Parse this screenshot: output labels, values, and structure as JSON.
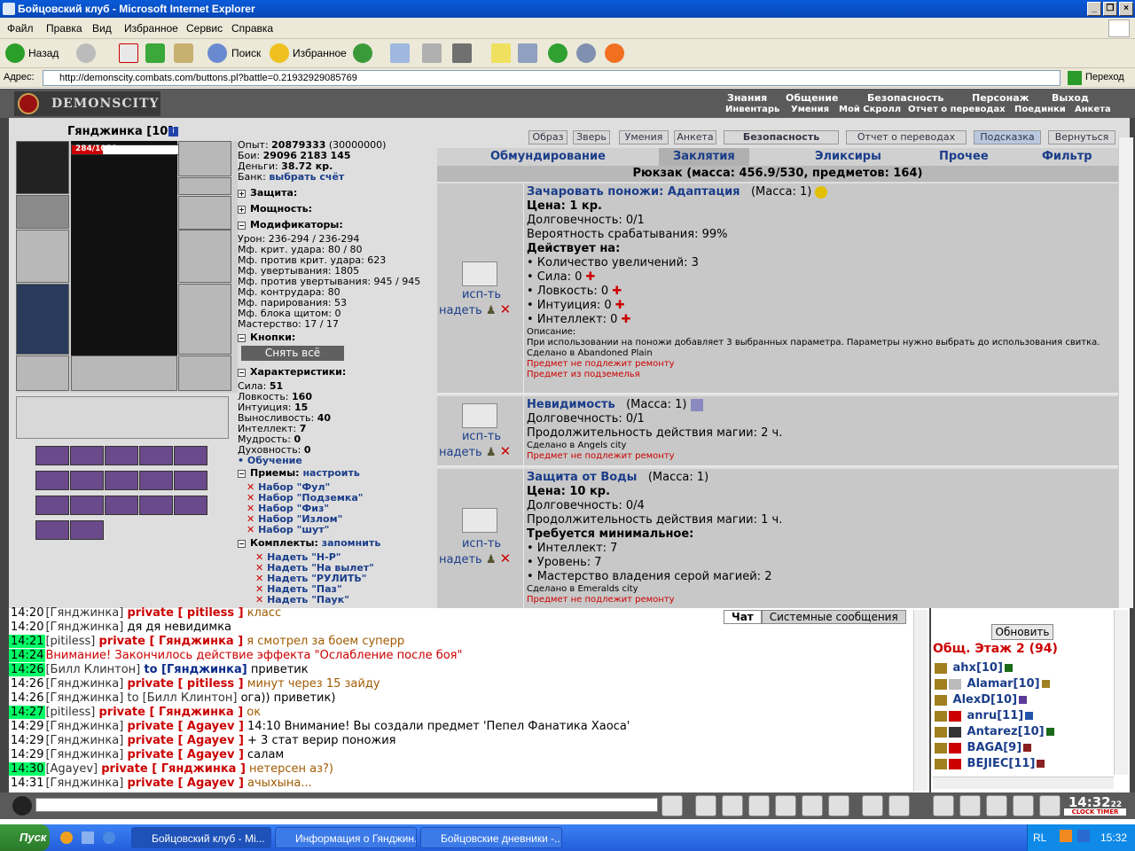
{
  "window": {
    "title": "Бойцовский клуб - Microsoft Internet Explorer"
  },
  "menu": [
    "Файл",
    "Правка",
    "Вид",
    "Избранное",
    "Сервис",
    "Справка"
  ],
  "toolbar": {
    "back": "Назад",
    "search": "Поиск",
    "favorites": "Избранное"
  },
  "address": {
    "label": "Адрес:",
    "url": "http://demonscity.combats.com/buttons.pl?battle=0.21932929085769",
    "go": "Переход"
  },
  "game_header": {
    "logo": "DEMONSCITY",
    "top_links": [
      "Знания",
      "Общение",
      "Безопасность",
      "Персонаж",
      "Выход"
    ],
    "sub_links": [
      "Инвентарь",
      "Умения",
      "Мой Скролл",
      "Отчет о переводах",
      "Поединки",
      "Анкета"
    ]
  },
  "character": {
    "name": "Гянджинка [10]",
    "hp": "284/1058",
    "hp_fraction": 0.27,
    "experience_label": "Опыт:",
    "experience": "20879333",
    "experience_next": "(30000000)",
    "fights_label": "Бои:",
    "wins": "29096",
    "losses": "2183",
    "draws": "145",
    "money_label": "Деньги:",
    "money": "38.72 кр.",
    "bank_label": "Банк:",
    "bank": "выбрать счёт"
  },
  "sections": {
    "protection": "Защита:",
    "power": "Мощность:",
    "modifiers": "Модификаторы:",
    "buttons": "Кнопки:",
    "stats": "Характеристики:",
    "tricks": "Приемы:",
    "tricks_setup": "настроить",
    "sets": "Комплекты:",
    "sets_save": "запомнить"
  },
  "modifiers": [
    "Урон: 236-294 / 236-294",
    "Мф. крит. удара: 80 / 80",
    "Мф. против крит. удара: 623",
    "Мф. увертывания: 1805",
    "Мф. против увертывания: 945 / 945",
    "Мф. контрудара: 80",
    "Мф. парирования: 53",
    "Мф. блока щитом: 0",
    "Мастерство: 17 / 17"
  ],
  "undress_button": "Снять всё",
  "stats": [
    {
      "label": "Сила:",
      "value": "51"
    },
    {
      "label": "Ловкость:",
      "value": "160"
    },
    {
      "label": "Интуиция:",
      "value": "15"
    },
    {
      "label": "Выносливость:",
      "value": "40"
    },
    {
      "label": "Интеллект:",
      "value": "7"
    },
    {
      "label": "Мудрость:",
      "value": "0"
    },
    {
      "label": "Духовность:",
      "value": "0"
    }
  ],
  "training": "• Обучение",
  "trick_sets": [
    "Набор \"Фул\"",
    "Набор \"Подземка\"",
    "Набор \"Физ\"",
    "Набор \"Излом\"",
    "Набор \"шут\""
  ],
  "kit_sets": [
    "Надеть \"Н-Р\"",
    "Надеть \"На вылет\"",
    "Надеть \"РУЛИТЬ\"",
    "Надеть \"Паз\"",
    "Надеть \"Паук\""
  ],
  "nav_buttons": [
    "Образ",
    "Зверь",
    "Умения",
    "Анкета",
    "Безопасность",
    "Отчет о переводах",
    "Подсказка",
    "Вернуться"
  ],
  "inv_tabs": [
    "Обмундирование",
    "Заклятия",
    "Эликсиры",
    "Прочее",
    "Фильтр"
  ],
  "rucksack": "Рюкзак (масса: 456.9/530, предметов: 164)",
  "item_actions": {
    "use": "исп-ть",
    "wear": "надеть"
  },
  "items": [
    {
      "name": "Зачаровать поножи: Адаптация",
      "mass": "(Масса: 1)",
      "lines": [
        "Цена: 1 кр.",
        "Долговечность: 0/1",
        "Вероятность срабатывания: 99%",
        "Действует на:"
      ],
      "bullets": [
        "• Количество увеличений: 3",
        "• Сила: 0",
        "• Ловкость: 0",
        "• Интуиция: 0",
        "• Интеллект: 0"
      ],
      "desc_label": "Описание:",
      "desc": "При использовании на поножи добавляет 3 выбранных параметра. Параметры нужно выбрать до использования свитка.",
      "made": "Сделано в Abandoned Plain",
      "red": [
        "Предмет не подлежит ремонту",
        "Предмет из подземелья"
      ]
    },
    {
      "name": "Невидимость",
      "mass": "(Масса: 1)",
      "lines": [
        "Долговечность: 0/1",
        "Продолжительность действия магии: 2 ч."
      ],
      "made": "Сделано в Angels city",
      "red": [
        "Предмет не подлежит ремонту"
      ]
    },
    {
      "name": "Защита от Воды",
      "mass": "(Масса: 1)",
      "lines": [
        "Цена: 10 кр.",
        "Долговечность: 0/4",
        "Продолжительность действия магии: 1 ч.",
        "Требуется минимальное:"
      ],
      "bullets": [
        "• Интеллект: 7",
        "• Уровень: 7",
        "• Мастерство владения серой магией: 2"
      ],
      "made": "Сделано в Emeralds city",
      "red": [
        "Предмет не подлежит ремонту"
      ]
    }
  ],
  "chat_tabs": [
    "Чат",
    "Системные сообщения"
  ],
  "chat": [
    {
      "t": "14:20",
      "hl": false,
      "nick": "[Гянджинка]",
      "kind": "priv",
      "to": "private [ pitiless ]",
      "msg": "класс",
      "mc": "txt"
    },
    {
      "t": "14:20",
      "hl": false,
      "nick": "[Гянджинка]",
      "kind": "",
      "to": "",
      "msg": "дя дя невидимка",
      "mc": "plain"
    },
    {
      "t": "14:21",
      "hl": true,
      "nick": "[pitiless]",
      "kind": "priv",
      "to": "private [ Гянджинка ]",
      "msg": "я смотрел за боем суперр",
      "mc": "txt"
    },
    {
      "t": "14:24",
      "hl": true,
      "nick": "",
      "kind": "warn",
      "to": "",
      "msg": "Внимание! Закончилось действие эффекта \"Ослабление после боя\"",
      "mc": "warn"
    },
    {
      "t": "14:26",
      "hl": true,
      "nick": "[Билл Клинтон]",
      "kind": "to",
      "to": "to [Гянджинка]",
      "msg": "приветик",
      "mc": "plain"
    },
    {
      "t": "14:26",
      "hl": false,
      "nick": "[Гянджинка]",
      "kind": "priv",
      "to": "private [ pitiless ]",
      "msg": "минут через 15 зайду",
      "mc": "txt"
    },
    {
      "t": "14:26",
      "hl": false,
      "nick": "[Гянджинка]",
      "kind": "plainto",
      "to": "to [Билл Клинтон]",
      "msg": "ога)) приветик)",
      "mc": "plain"
    },
    {
      "t": "14:27",
      "hl": true,
      "nick": "[pitiless]",
      "kind": "priv",
      "to": "private [ Гянджинка ]",
      "msg": "ок",
      "mc": "txt"
    },
    {
      "t": "14:29",
      "hl": false,
      "nick": "[Гянджинка]",
      "kind": "priv",
      "to": "private [ Agayev ]",
      "msg": "14:10 Внимание! Вы создали предмет 'Пепел Фанатика Хаоса'",
      "mc": "plain"
    },
    {
      "t": "14:29",
      "hl": false,
      "nick": "[Гянджинка]",
      "kind": "priv",
      "to": "private [ Agayev ]",
      "msg": "+ 3 стат верир поножия",
      "mc": "plain"
    },
    {
      "t": "14:29",
      "hl": false,
      "nick": "[Гянджинка]",
      "kind": "priv",
      "to": "private [ Agayev ]",
      "msg": "салам",
      "mc": "plain"
    },
    {
      "t": "14:30",
      "hl": true,
      "nick": "[Agayev]",
      "kind": "priv",
      "to": "private [ Гянджинка ]",
      "msg": "нетерсен аз?)",
      "mc": "txt"
    },
    {
      "t": "14:31",
      "hl": false,
      "nick": "[Гянджинка]",
      "kind": "priv",
      "to": "private [ Agayev ]",
      "msg": "ачыхына...",
      "mc": "txt"
    }
  ],
  "online": {
    "refresh": "Обновить",
    "floor": "Общ. Этаж 2 (94)",
    "users": [
      "ahx[10]",
      "Alamar[10]",
      "AlexD[10]",
      "anru[11]",
      "Antarez[10]",
      "BAGA[9]",
      "BEJIEC[11]"
    ]
  },
  "clock": {
    "time": "14:32",
    "sec": "22",
    "label": "CLOCK TIMER"
  },
  "taskbar": {
    "start": "Пуск",
    "tasks": [
      "Бойцовский клуб - Mi...",
      "Информация о Гянджин...",
      "Бойцовские дневники -..."
    ],
    "lang": "RL",
    "time": "15:32"
  }
}
